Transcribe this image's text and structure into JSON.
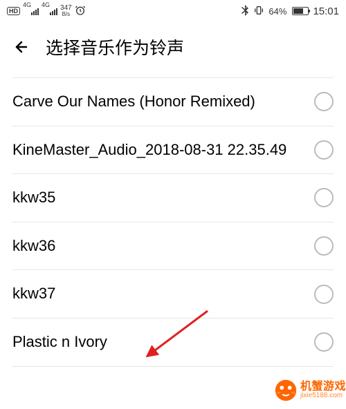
{
  "status_bar": {
    "hd": "HD",
    "fourg1": "4G",
    "fourg2": "4G",
    "speed_num": "347",
    "speed_unit": "B/s",
    "battery_percent": "64%",
    "time": "15:01"
  },
  "header": {
    "title": "选择音乐作为铃声"
  },
  "list": {
    "items": [
      {
        "label": "Carve Our Names (Honor Remixed)"
      },
      {
        "label": "KineMaster_Audio_2018-08-31 22.35.49"
      },
      {
        "label": "kkw35"
      },
      {
        "label": "kkw36"
      },
      {
        "label": "kkw37"
      },
      {
        "label": "Plastic n Ivory"
      }
    ]
  },
  "watermark": {
    "main": "机蟹游戏",
    "sub": "jixie5188.com"
  }
}
